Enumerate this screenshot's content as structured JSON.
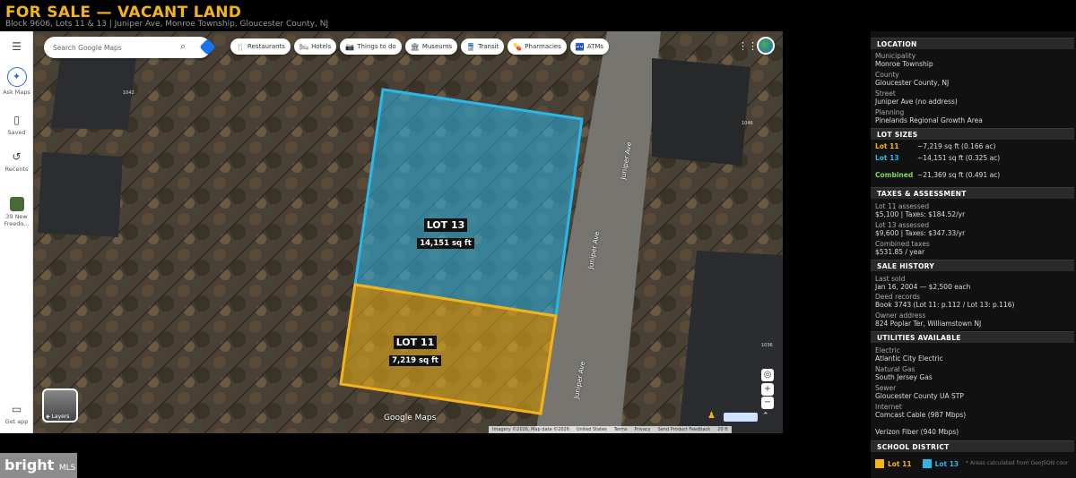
{
  "header": {
    "title": "FOR SALE — VACANT LAND",
    "subtitle": "Block 9606, Lots 11 & 13  |  Juniper Ave, Monroe Township, Gloucester County, NJ"
  },
  "rail": {
    "menu_icon": "menu-icon",
    "ask_maps": "Ask Maps",
    "saved": "Saved",
    "recents": "Recents",
    "place": "39 New Freedo...",
    "get_app": "Get app"
  },
  "search": {
    "placeholder": "Search Google Maps"
  },
  "chips": [
    {
      "icon": "🍴",
      "label": "Restaurants"
    },
    {
      "icon": "🛏",
      "label": "Hotels"
    },
    {
      "icon": "📷",
      "label": "Things to do"
    },
    {
      "icon": "🏛",
      "label": "Museums"
    },
    {
      "icon": "🚆",
      "label": "Transit"
    },
    {
      "icon": "💊",
      "label": "Pharmacies"
    },
    {
      "icon": "🏧",
      "label": "ATMs"
    }
  ],
  "map": {
    "lot13": {
      "name": "LOT 13",
      "area": "14,151 sq ft"
    },
    "lot11": {
      "name": "LOT 11",
      "area": "7,219 sq ft"
    },
    "street_name": "Juniper Ave",
    "house_numbers": [
      "1042",
      "1046",
      "1036"
    ],
    "layers_label": "Layers",
    "brand": "Google Maps",
    "attribution": [
      "Imagery ©2026, Map data ©2026",
      "United States",
      "Terms",
      "Privacy",
      "Send Product Feedback",
      "20 ft"
    ]
  },
  "sidebar": {
    "location": {
      "heading": "LOCATION",
      "rows": [
        {
          "k": "Municipality",
          "v": "Monroe Township"
        },
        {
          "k": "County",
          "v": "Gloucester County, NJ"
        },
        {
          "k": "Street",
          "v": "Juniper Ave (no address)"
        },
        {
          "k": "Planning",
          "v": "Pinelands Regional Growth Area"
        }
      ]
    },
    "lot_sizes": {
      "heading": "LOT SIZES",
      "lot11": {
        "k": "Lot 11",
        "v": "~7,219 sq ft  (0.166 ac)"
      },
      "lot13": {
        "k": "Lot 13",
        "v": "~14,151 sq ft  (0.325 ac)"
      },
      "combined": {
        "k": "Combined",
        "v": "~21,369 sq ft  (0.491 ac)"
      }
    },
    "taxes": {
      "heading": "TAXES & ASSESSMENT",
      "rows": [
        {
          "k": "Lot 11 assessed",
          "v": "$5,100  |  Taxes: $184.52/yr"
        },
        {
          "k": "Lot 13 assessed",
          "v": "$9,600  |  Taxes: $347.33/yr"
        },
        {
          "k": "Combined taxes",
          "v": "$531.85 / year"
        }
      ]
    },
    "sale_history": {
      "heading": "SALE HISTORY",
      "rows": [
        {
          "k": "Last sold",
          "v": "Jan 16, 2004 — $2,500 each"
        },
        {
          "k": "Deed records",
          "v": "Book 3743  (Lot 11: p.112 / Lot 13: p.116)"
        },
        {
          "k": "Owner address",
          "v": "824 Poplar Ter, Williamstown NJ"
        }
      ]
    },
    "utilities": {
      "heading": "UTILITIES AVAILABLE",
      "rows": [
        {
          "k": "Electric",
          "v": "Atlantic City Electric"
        },
        {
          "k": "Natural Gas",
          "v": "South Jersey Gas"
        },
        {
          "k": "Sewer",
          "v": "Gloucester County UA STP"
        },
        {
          "k": "Internet",
          "v": "Comcast Cable (987 Mbps)"
        }
      ],
      "extra": "Verizon Fiber (940 Mbps)"
    },
    "school": {
      "heading": "SCHOOL DISTRICT"
    },
    "legend": {
      "lot11": "Lot 11",
      "lot13": "Lot 13",
      "note": "* Areas calculated from GeoJSON coor",
      "colors": {
        "lot11": "#f2b418",
        "lot13": "#2cb7e8"
      }
    }
  },
  "watermark": {
    "brand": "bright",
    "suffix": "MLS"
  }
}
